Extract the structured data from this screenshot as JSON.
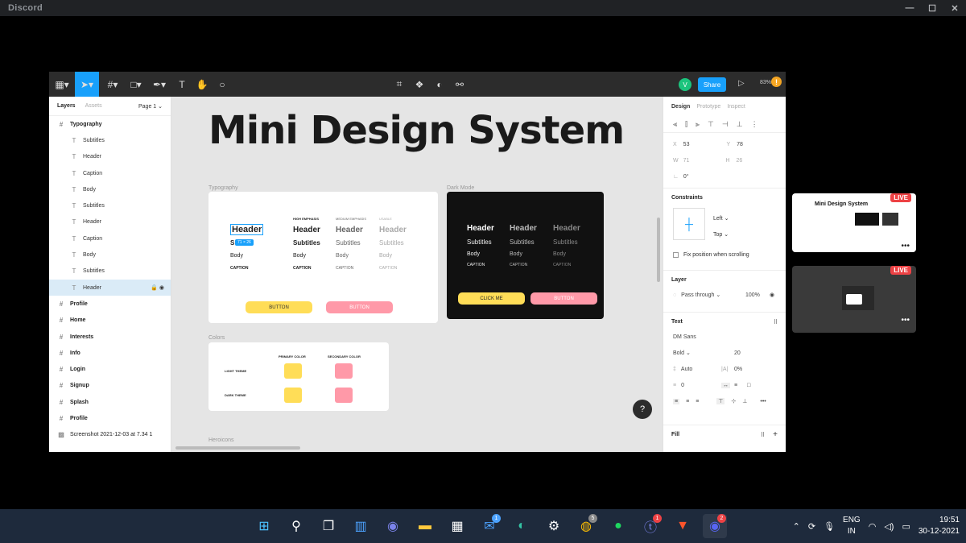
{
  "window": {
    "title": "Discord",
    "controls": [
      "—",
      "☐",
      "✕"
    ]
  },
  "figma": {
    "toolbar": {
      "share": "Share",
      "avatar": "V",
      "zoom": "83%",
      "notice": "!"
    },
    "left_panel": {
      "tabs": [
        "Layers",
        "Assets"
      ],
      "page": "Page 1 ⌄",
      "layers": [
        {
          "name": "Typography",
          "kind": "frame"
        },
        {
          "name": "Subtitles",
          "kind": "text"
        },
        {
          "name": "Header",
          "kind": "text"
        },
        {
          "name": "Caption",
          "kind": "text"
        },
        {
          "name": "Body",
          "kind": "text"
        },
        {
          "name": "Subtitles",
          "kind": "text"
        },
        {
          "name": "Header",
          "kind": "text"
        },
        {
          "name": "Caption",
          "kind": "text"
        },
        {
          "name": "Body",
          "kind": "text"
        },
        {
          "name": "Subtitles",
          "kind": "text"
        },
        {
          "name": "Header",
          "kind": "text",
          "selected": true
        },
        {
          "name": "Profile",
          "kind": "frame"
        },
        {
          "name": "Home",
          "kind": "frame"
        },
        {
          "name": "Interests",
          "kind": "frame"
        },
        {
          "name": "Info",
          "kind": "frame"
        },
        {
          "name": "Login",
          "kind": "frame"
        },
        {
          "name": "Signup",
          "kind": "frame"
        },
        {
          "name": "Splash",
          "kind": "frame"
        },
        {
          "name": "Profile",
          "kind": "frame"
        },
        {
          "name": "Screenshot 2021-12-03 at 7.34 1",
          "kind": "image"
        }
      ]
    },
    "canvas": {
      "title": "Mini Design System",
      "typography_label": "Typography",
      "darkmode_label": "Dark Mode",
      "colors_label": "Colors",
      "heroicons_label": "Heroicons",
      "selection_size": "71 × 26",
      "col_heads": [
        "HIGH EMPHASIS",
        "MEDIUM EMPHASIS",
        "USABLE"
      ],
      "type_rows": [
        "Header",
        "Subtitles",
        "Body",
        "CAPTION"
      ],
      "sel_header": "Header",
      "sel_sub": "S",
      "light_buttons": [
        "BUTTON",
        "BUTTON"
      ],
      "dark_buttons": [
        "CLICK ME",
        "BUTTON"
      ],
      "colors": {
        "primary": "PRIMARY COLOR",
        "secondary": "SECONDARY COLOR",
        "light": "LIGHT THEME",
        "dark": "DARK THEME",
        "yellow": "#ffdd57",
        "pink": "#ff99a8"
      }
    },
    "right_panel": {
      "tabs": [
        "Design",
        "Prototype",
        "Inspect"
      ],
      "x": "53",
      "y": "78",
      "w": "71",
      "h": "26",
      "rotation": "0°",
      "x_label": "X",
      "y_label": "Y",
      "w_label": "W",
      "h_label": "H",
      "constraints": "Constraints",
      "c_left": "Left ⌄",
      "c_top": "Top ⌄",
      "fix": "Fix position when scrolling",
      "layer": "Layer",
      "pass": "Pass through ⌄",
      "opacity": "100%",
      "text": "Text",
      "font": "DM Sans",
      "weight": "Bold ⌄",
      "size": "20",
      "line": "Auto",
      "letter": "0%",
      "para": "0",
      "fill": "Fill"
    }
  },
  "call": {
    "tile1_title": "Mini Design System",
    "live": "LIVE",
    "more": "•••"
  },
  "taskbar": {
    "lang1": "ENG",
    "lang2": "IN",
    "time": "19:51",
    "date": "30-12-2021",
    "mail_badge": "1",
    "chrome_badge": "5",
    "teams_badge": "1",
    "discord_badge": "2"
  }
}
